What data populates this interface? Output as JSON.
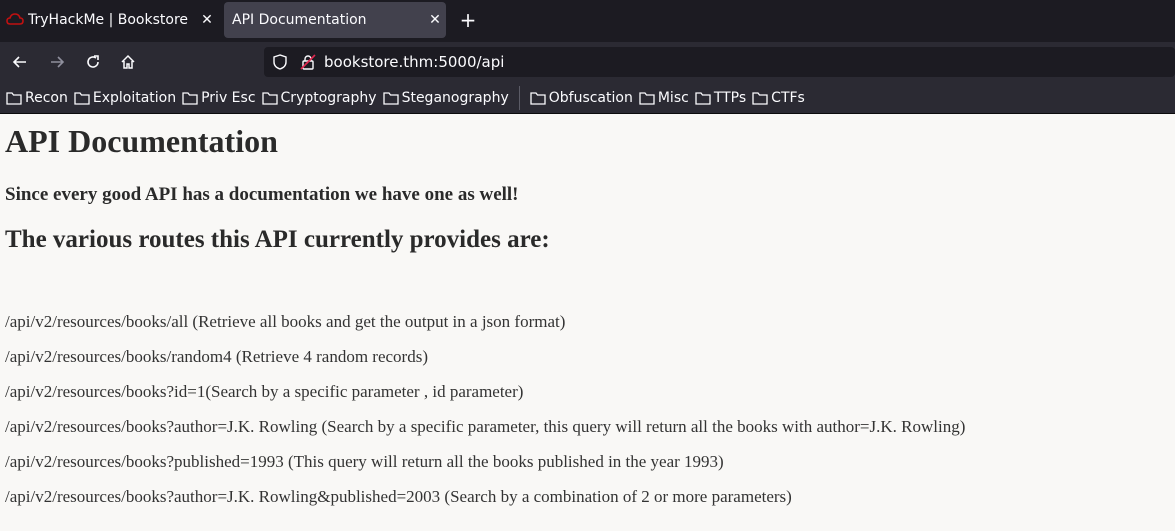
{
  "browser": {
    "tabs": [
      {
        "label": "TryHackMe | Bookstore"
      },
      {
        "label": "API Documentation"
      }
    ],
    "url": "bookstore.thm:5000/api",
    "bookmarks": [
      {
        "label": "Recon"
      },
      {
        "label": "Exploitation"
      },
      {
        "label": "Priv Esc"
      },
      {
        "label": "Cryptography"
      },
      {
        "label": "Steganography"
      },
      {
        "label": "Obfuscation"
      },
      {
        "label": "Misc"
      },
      {
        "label": "TTPs"
      },
      {
        "label": "CTFs"
      }
    ]
  },
  "page": {
    "title": "API Documentation",
    "intro": "Since every good API has a documentation we have one as well!",
    "routes_heading": "The various routes this API currently provides are:",
    "routes": [
      "/api/v2/resources/books/all (Retrieve all books and get the output in a json format)",
      "/api/v2/resources/books/random4 (Retrieve 4 random records)",
      "/api/v2/resources/books?id=1(Search by a specific parameter , id parameter)",
      "/api/v2/resources/books?author=J.K. Rowling (Search by a specific parameter, this query will return all the books with author=J.K. Rowling)",
      "/api/v2/resources/books?published=1993 (This query will return all the books published in the year 1993)",
      "/api/v2/resources/books?author=J.K. Rowling&published=2003 (Search by a combination of 2 or more parameters)"
    ]
  }
}
